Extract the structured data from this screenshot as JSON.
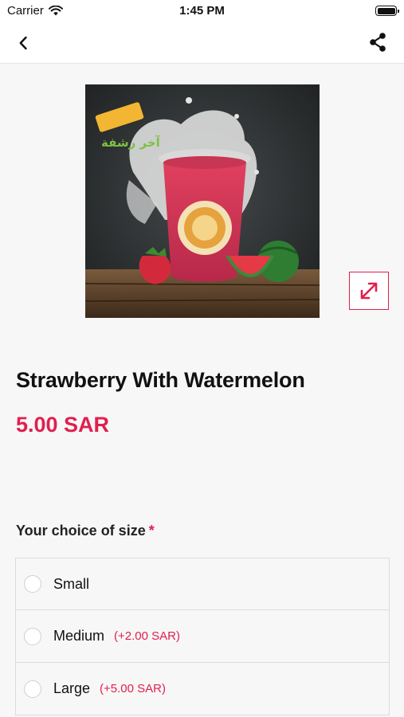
{
  "status_bar": {
    "carrier": "Carrier",
    "time": "1:45 PM"
  },
  "nav": {
    "back_icon": "chevron-left-icon",
    "share_icon": "share-icon"
  },
  "product": {
    "image_icon": "product-photo",
    "title": "Strawberry With Watermelon",
    "price": "5.00 SAR",
    "brand_text": "آخر رشفة"
  },
  "size_group": {
    "heading": "Your choice of size",
    "required_mark": "*",
    "options": [
      {
        "label": "Small",
        "extra": ""
      },
      {
        "label": "Medium",
        "extra": "(+2.00 SAR)"
      },
      {
        "label": "Large",
        "extra": "(+5.00 SAR)"
      }
    ]
  },
  "colors": {
    "accent": "#e0204e",
    "background": "#f7f7f7"
  }
}
